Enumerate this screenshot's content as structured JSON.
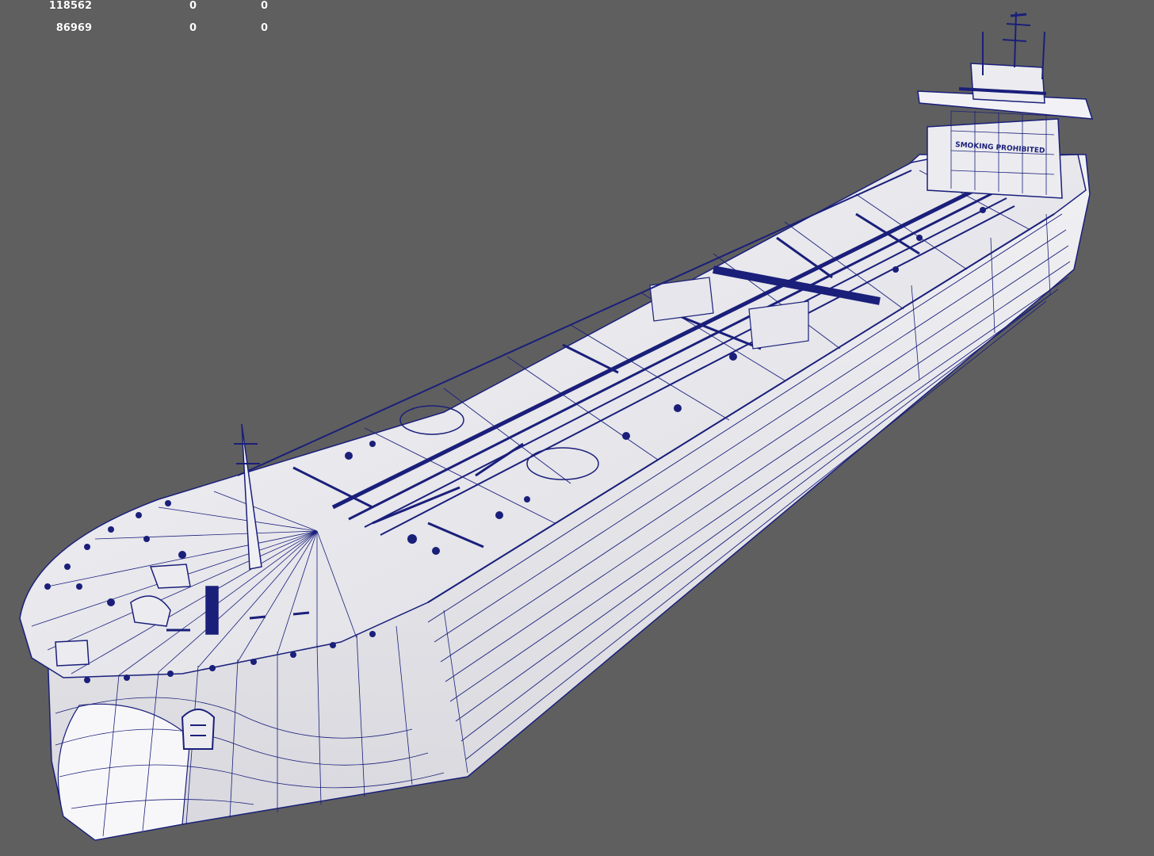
{
  "viewport": {
    "background": "#5f5f5f",
    "model_color": "#e9e9ee",
    "wire_color": "#1a1f7a",
    "hull_text": "SMOKING PROHIBITED"
  },
  "stats": {
    "rows": [
      {
        "a": "118562",
        "b": "0",
        "c": "0"
      },
      {
        "a": "86969",
        "b": "0",
        "c": "0"
      }
    ]
  }
}
